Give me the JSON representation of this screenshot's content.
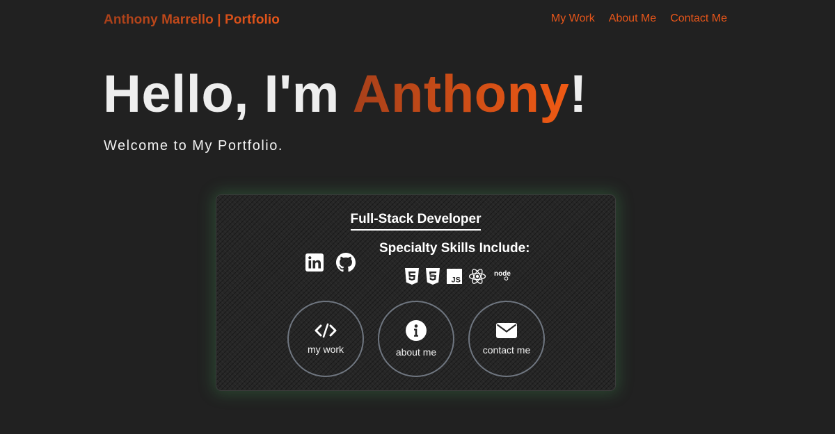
{
  "header": {
    "brand": "Anthony Marrello | Portfolio",
    "nav": [
      {
        "label": "My Work"
      },
      {
        "label": "About Me"
      },
      {
        "label": "Contact Me"
      }
    ]
  },
  "hero": {
    "greeting_prefix": "Hello, I'm ",
    "name": "Anthony",
    "greeting_suffix": "!",
    "subtitle": "Welcome to My Portfolio."
  },
  "card": {
    "title": "Full-Stack Developer",
    "skills_heading": "Specialty Skills Include:",
    "social_icons": [
      "linkedin-icon",
      "github-icon"
    ],
    "skill_icons": [
      "html5-icon",
      "css3-icon",
      "javascript-icon",
      "react-icon",
      "nodejs-icon"
    ],
    "skill_icon_text": {
      "js": "JS",
      "node": "node"
    },
    "buttons": [
      {
        "label": "my work",
        "icon": "code-icon"
      },
      {
        "label": "about me",
        "icon": "info-icon"
      },
      {
        "label": "contact me",
        "icon": "envelope-icon"
      }
    ]
  },
  "colors": {
    "background": "#212121",
    "accent": "#e8561a",
    "accent_dark": "#a8401a",
    "card_glow": "#46aa5a",
    "circle_border": "#6f7680"
  }
}
